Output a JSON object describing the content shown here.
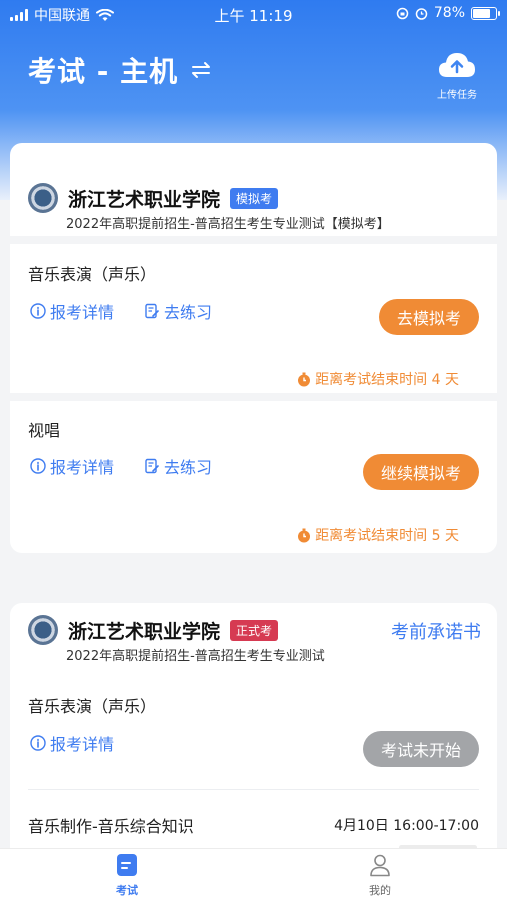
{
  "status_bar": {
    "carrier": "中国联通",
    "time": "上午 11:19",
    "battery": "78%"
  },
  "header": {
    "title": "考试 - 主机",
    "upload_label": "上传任务"
  },
  "card1": {
    "school": "浙江艺术职业学院",
    "tag": "模拟考",
    "subtitle": "2022年高职提前招生-普高招生考生专业测试【模拟考】",
    "subjects": [
      {
        "name": "音乐表演（声乐）",
        "link_detail": "报考详情",
        "link_practice": "去练习",
        "button": "去模拟考",
        "deadline": "距离考试结束时间 4 天"
      },
      {
        "name": "视唱",
        "link_detail": "报考详情",
        "link_practice": "去练习",
        "button": "继续模拟考",
        "deadline": "距离考试结束时间 5 天"
      }
    ]
  },
  "card2": {
    "school": "浙江艺术职业学院",
    "tag": "正式考",
    "promise_link": "考前承诺书",
    "subtitle": "2022年高职提前招生-普高招生考生专业测试",
    "subjects": [
      {
        "name": "音乐表演（声乐）",
        "link_detail": "报考详情",
        "button": "考试未开始"
      },
      {
        "name": "音乐制作-音乐综合知识",
        "time": "4月10日 16:00-17:00"
      }
    ]
  },
  "tabbar": {
    "exam": "考试",
    "mine": "我的"
  },
  "colors": {
    "primary": "#3f7cf0",
    "orange": "#f08b35",
    "formal_tag": "#d63a52",
    "disabled": "#a3a5a8"
  }
}
